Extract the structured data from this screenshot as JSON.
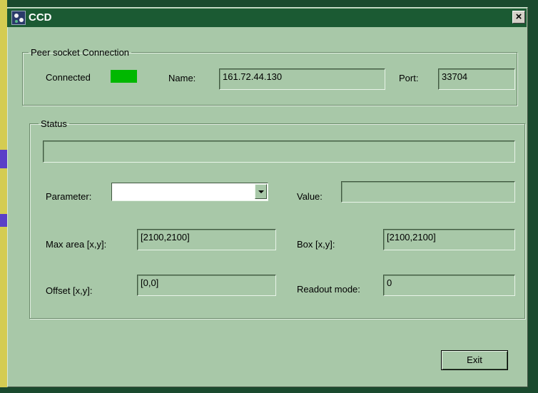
{
  "window": {
    "title": "CCD",
    "close_label": "×"
  },
  "connection": {
    "group_label": "Peer socket Connection",
    "status_label": "Connected",
    "status_color": "#00b800",
    "name_label": "Name:",
    "name_value": "161.72.44.130",
    "port_label": "Port:",
    "port_value": "33704"
  },
  "status": {
    "group_label": "Status",
    "message": "",
    "parameter_label": "Parameter:",
    "parameter_value": "",
    "value_label": "Value:",
    "value_value": "",
    "max_area_label": "Max area [x,y]:",
    "max_area_value": "[2100,2100]",
    "box_label": "Box [x,y]:",
    "box_value": "[2100,2100]",
    "offset_label": "Offset [x,y]:",
    "offset_value": "[0,0]",
    "readout_label": "Readout mode:",
    "readout_value": "0"
  },
  "buttons": {
    "exit_label": "Exit"
  }
}
